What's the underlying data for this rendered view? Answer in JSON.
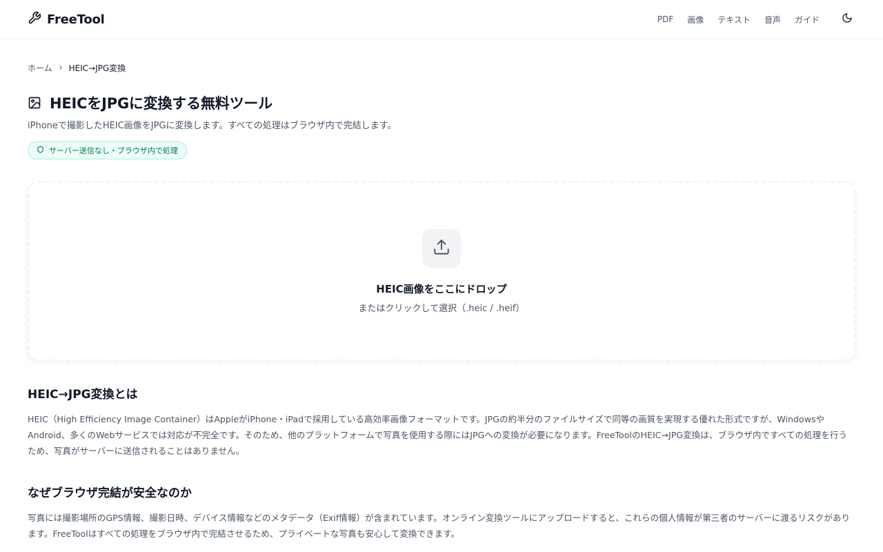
{
  "header": {
    "brand": "FreeTool",
    "nav": [
      "PDF",
      "画像",
      "テキスト",
      "音声",
      "ガイド"
    ]
  },
  "breadcrumb": {
    "home": "ホーム",
    "current": "HEIC→JPG変換"
  },
  "page": {
    "title": "HEICをJPGに変換する無料ツール",
    "subtitle": "iPhoneで撮影したHEIC画像をJPGに変換します。すべての処理はブラウザ内で完結します。",
    "badge": "サーバー送信なし・ブラウザ内で処理"
  },
  "dropzone": {
    "title": "HEIC画像をここにドロップ",
    "hint": "またはクリックして選択（.heic / .heif）"
  },
  "sections": [
    {
      "title": "HEIC→JPG変換とは",
      "body": "HEIC（High Efficiency Image Container）はAppleがiPhone・iPadで採用している高効率画像フォーマットです。JPGの約半分のファイルサイズで同等の画質を実現する優れた形式ですが、WindowsやAndroid、多くのWebサービスでは対応が不完全です。そのため、他のプラットフォームで写真を使用する際にはJPGへの変換が必要になります。FreeToolのHEIC→JPG変換は、ブラウザ内ですべての処理を行うため、写真がサーバーに送信されることはありません。"
    },
    {
      "title": "なぜブラウザ完結が安全なのか",
      "body": "写真には撮影場所のGPS情報、撮影日時、デバイス情報などのメタデータ（Exif情報）が含まれています。オンライン変換ツールにアップロードすると、これらの個人情報が第三者のサーバーに渡るリスクがあります。FreeToolはすべての処理をブラウザ内で完結させるため、プライベートな写真も安心して変換できます。"
    }
  ],
  "icons": {
    "brand": "wrench-icon",
    "theme": "moon-icon",
    "breadcrumb_sep": "chevron-right-icon",
    "title": "image-icon",
    "badge": "shield-icon",
    "upload": "upload-icon"
  },
  "colors": {
    "text": "#111827",
    "muted": "#4b5563",
    "badge_text": "#047857",
    "badge_bg": "#ecfdf5",
    "badge_border": "#a7f3d0"
  }
}
